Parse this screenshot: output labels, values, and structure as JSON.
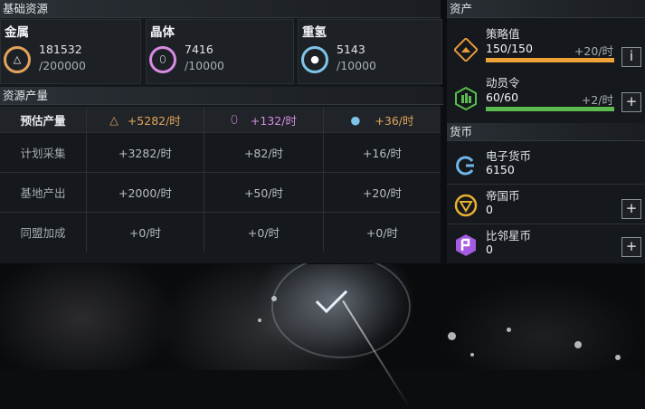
{
  "base": {
    "title": "基础资源",
    "resources": [
      {
        "name": "金属",
        "current": "181532",
        "max": "/200000",
        "icon": "metal-triangle-icon",
        "color": "#e4a35a"
      },
      {
        "name": "晶体",
        "current": "7416",
        "max": "/10000",
        "icon": "crystal-icon",
        "color": "#d78be4"
      },
      {
        "name": "重氢",
        "current": "5143",
        "max": "/10000",
        "icon": "deuterium-icon",
        "color": "#7fc4e8"
      }
    ]
  },
  "production": {
    "title": "资源产量",
    "header": {
      "label": "预估产量",
      "metal": "+5282/时",
      "crystal": "+132/时",
      "gas": "+36/时"
    },
    "rows": [
      {
        "label": "计划采集",
        "metal": "+3282/时",
        "crystal": "+82/时",
        "gas": "+16/时"
      },
      {
        "label": "基地产出",
        "metal": "+2000/时",
        "crystal": "+50/时",
        "gas": "+20/时"
      },
      {
        "label": "同盟加成",
        "metal": "+0/时",
        "crystal": "+0/时",
        "gas": "+0/时"
      }
    ]
  },
  "assets": {
    "title": "资产",
    "items": [
      {
        "label": "策略值",
        "value": "150/150",
        "rate": "+20/时",
        "fill": 1.0,
        "bar_color": "#f0a23a",
        "button": "i",
        "icon": "strategy-icon"
      },
      {
        "label": "动员令",
        "value": "60/60",
        "rate": "+2/时",
        "fill": 1.0,
        "bar_color": "#5bbb4e",
        "button": "+",
        "icon": "mobilization-icon"
      }
    ]
  },
  "currency": {
    "title": "货币",
    "items": [
      {
        "label": "电子货币",
        "value": "6150",
        "icon": "e-currency-icon",
        "button": ""
      },
      {
        "label": "帝国币",
        "value": "0",
        "icon": "empire-coin-icon",
        "button": "+"
      },
      {
        "label": "比邻星币",
        "value": "0",
        "icon": "proxima-coin-icon",
        "button": "+"
      }
    ]
  }
}
